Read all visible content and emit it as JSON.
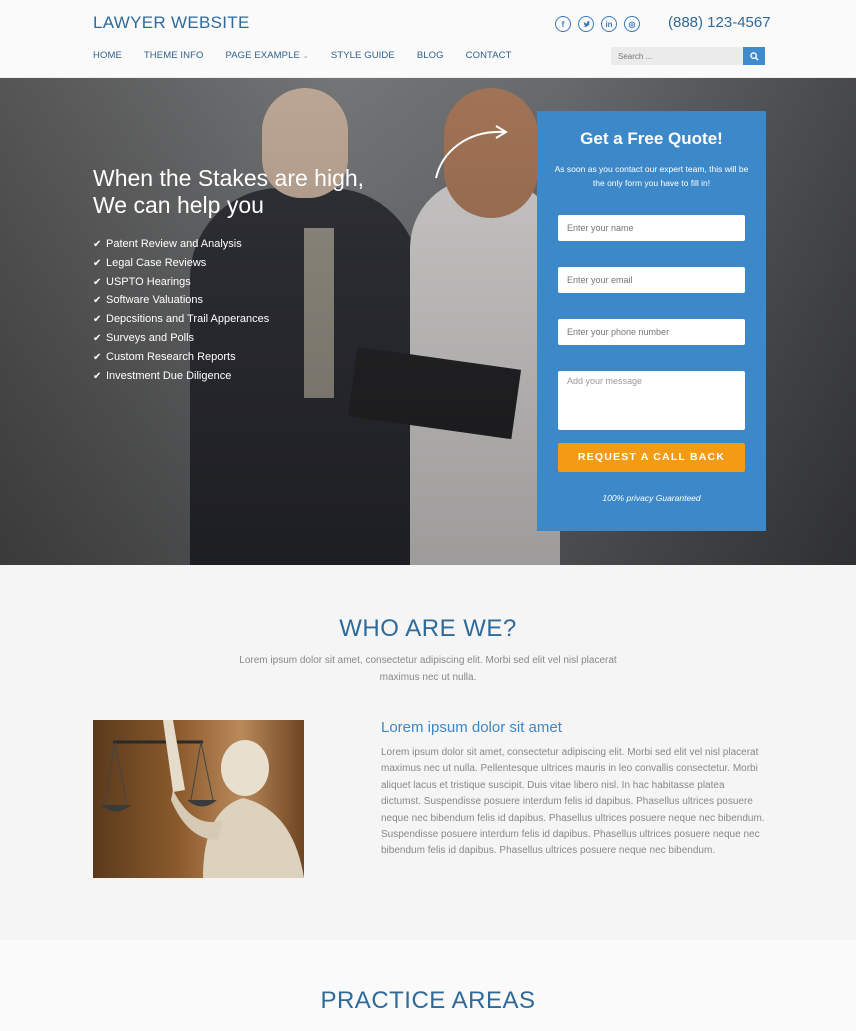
{
  "header": {
    "logo": "LAWYER WEBSITE",
    "phone": "(888) 123-4567",
    "socials": [
      {
        "icon": "facebook-icon",
        "glyph": "f"
      },
      {
        "icon": "twitter-icon",
        "glyph": "t"
      },
      {
        "icon": "linkedin-icon",
        "glyph": "in"
      },
      {
        "icon": "instagram-icon",
        "glyph": "◎"
      }
    ],
    "nav": [
      "HOME",
      "THEME INFO",
      "PAGE EXAMPLE",
      "STYLE GUIDE",
      "BLOG",
      "CONTACT"
    ],
    "search_placeholder": "Search ..."
  },
  "hero": {
    "headline_line1": "When the Stakes are high,",
    "headline_line2": "We can help you",
    "checklist": [
      "Patent Review and Analysis",
      "Legal Case Reviews",
      "USPTO Hearings",
      "Software Valuations",
      "Depcsitions and Trail Apperances",
      "Surveys and Polls",
      "Custom Research Reports",
      "Investment Due Diligence"
    ]
  },
  "quote_form": {
    "title": "Get a Free Quote!",
    "subtitle": "As soon as you contact our expert team, this will be the only form you have to fill in!",
    "name_placeholder": "Enter your name",
    "email_placeholder": "Enter your email",
    "phone_placeholder": "Enter your phone number",
    "message_placeholder": "Add your message",
    "button": "REQUEST A CALL BACK",
    "privacy": "100% privacy Guaranteed"
  },
  "who": {
    "title": "WHO ARE WE?",
    "subtitle": "Lorem ipsum dolor sit amet, consectetur adipiscing elit. Morbi sed elit vel nisl placerat maximus nec ut nulla.",
    "heading": "Lorem ipsum dolor sit amet",
    "body": "Lorem ipsum dolor sit amet, consectetur adipiscing elit. Morbi sed elit vel nisl placerat maximus nec ut nulla. Pellentesque ultrices mauris in leo convallis consectetur. Morbi aliquet lacus et tristique suscipit. Duis vitae libero nisl. In hac habitasse platea dictumst. Suspendisse posuere interdum felis id dapibus. Phasellus ultrices posuere neque nec bibendum felis id dapibus. Phasellus ultrices posuere neque nec bibendum. Suspendisse posuere interdum felis id dapibus. Phasellus ultrices posuere neque nec bibendum felis id dapibus. Phasellus ultrices posuere neque nec bibendum."
  },
  "practice": {
    "title": "PRACTICE AREAS"
  }
}
